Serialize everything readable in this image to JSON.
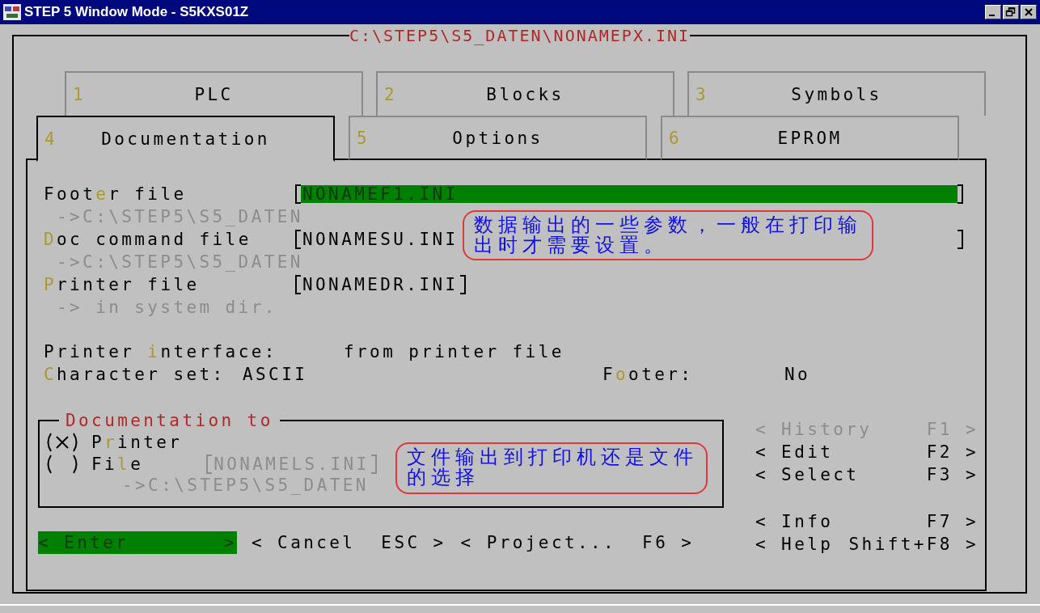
{
  "window": {
    "title": "STEP 5 Window Mode - S5KXS01Z"
  },
  "frame_title": "C:\\STEP5\\S5_DATEN\\NONAMEPX.INI",
  "tab_rows": [
    [
      {
        "number": "1",
        "label": "PLC",
        "selected": false
      },
      {
        "number": "2",
        "label": "Blocks",
        "selected": false
      },
      {
        "number": "3",
        "label": "Symbols",
        "selected": false
      }
    ],
    [
      {
        "number": "4",
        "label": "Documentation",
        "selected": true
      },
      {
        "number": "5",
        "label": "Options",
        "selected": false
      },
      {
        "number": "6",
        "label": "EPROM",
        "selected": false
      }
    ]
  ],
  "fields": [
    {
      "label": {
        "before": "Foot",
        "key": "e",
        "after": "r file"
      },
      "value": "NONAMEF1.INI",
      "kind": "long",
      "focused": true,
      "path": "->C:\\STEP5\\S5_DATEN"
    },
    {
      "label": {
        "key": "D",
        "after": "oc command file"
      },
      "value": "NONAMESU.INI",
      "kind": "long",
      "focused": false,
      "path": "->C:\\STEP5\\S5_DATEN",
      "callout": "数据输出的一些参数，一般在打印输出时才需要设置。"
    },
    {
      "label": {
        "key": "P",
        "after": "rinter file"
      },
      "value": "NONAMEDR.INI",
      "kind": "short",
      "focused": false,
      "path": "-> in system dir."
    }
  ],
  "printer_interface": {
    "label": {
      "before": "Printer ",
      "key": "i",
      "after": "nterface:"
    },
    "value": "from printer file"
  },
  "character_set": {
    "label": {
      "key": "C",
      "after": "haracter set:"
    },
    "value": "ASCII"
  },
  "footer": {
    "label": {
      "before": "F",
      "key": "o",
      "after": "oter:"
    },
    "value": "No"
  },
  "documentation_to": {
    "legend": "Documentation to",
    "options": [
      {
        "label": {
          "before": "P",
          "key": "r",
          "after": "inter"
        },
        "selected": true
      },
      {
        "label": {
          "before": "Fi",
          "key": "l",
          "after": "e"
        },
        "selected": false,
        "value": "NONAMELS.INI",
        "path": "->C:\\STEP5\\S5_DATEN"
      }
    ],
    "callout": "文件输出到打印机还是文件的选择"
  },
  "command_groups": [
    [
      {
        "label": "< History",
        "key": "F1 >",
        "disabled": true
      },
      {
        "label": "< Edit",
        "key": "F2 >",
        "disabled": false
      },
      {
        "label": "< Select",
        "key": "F3 >",
        "disabled": false
      }
    ],
    [
      {
        "label": "< Info",
        "key": "F7 >",
        "disabled": false
      },
      {
        "label": "< Help",
        "key": "Shift+F8 >",
        "disabled": false
      }
    ]
  ],
  "buttons": [
    {
      "label": "< Enter",
      "key": ">",
      "focused": true
    },
    {
      "label": "< Cancel",
      "key": "ESC >",
      "focused": false
    },
    {
      "label": "< Project...",
      "key": "F6 >",
      "focused": false
    }
  ]
}
